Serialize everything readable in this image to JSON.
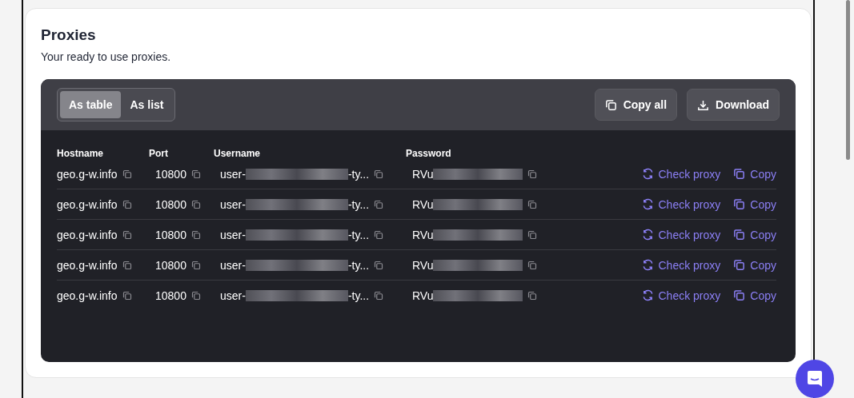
{
  "card": {
    "title": "Proxies",
    "subtitle": "Your ready to use proxies."
  },
  "view_toggle": [
    {
      "label": "As table",
      "selected": true
    },
    {
      "label": "As list",
      "selected": false
    }
  ],
  "toolbar_buttons": [
    {
      "label": "Copy all",
      "kind": "copy"
    },
    {
      "label": "Download",
      "kind": "download"
    }
  ],
  "table": {
    "columns": [
      "Hostname",
      "Port",
      "Username",
      "Password"
    ],
    "rows": [
      {
        "hostname": "geo.g-w.info",
        "port": "10800",
        "username_start": "user-",
        "username_end": "-ty...",
        "password_start": "RVu",
        "check": "Check proxy",
        "copy": "Copy"
      },
      {
        "hostname": "geo.g-w.info",
        "port": "10800",
        "username_start": "user-",
        "username_end": "-ty...",
        "password_start": "RVu",
        "check": "Check proxy",
        "copy": "Copy"
      },
      {
        "hostname": "geo.g-w.info",
        "port": "10800",
        "username_start": "user-",
        "username_end": "-ty...",
        "password_start": "RVu",
        "check": "Check proxy",
        "copy": "Copy"
      },
      {
        "hostname": "geo.g-w.info",
        "port": "10800",
        "username_start": "user-",
        "username_end": "-ty...",
        "password_start": "RVu",
        "check": "Check proxy",
        "copy": "Copy"
      },
      {
        "hostname": "geo.g-w.info",
        "port": "10800",
        "username_start": "user-",
        "username_end": "-ty...",
        "password_start": "RVu",
        "check": "Check proxy",
        "copy": "Copy"
      }
    ]
  }
}
